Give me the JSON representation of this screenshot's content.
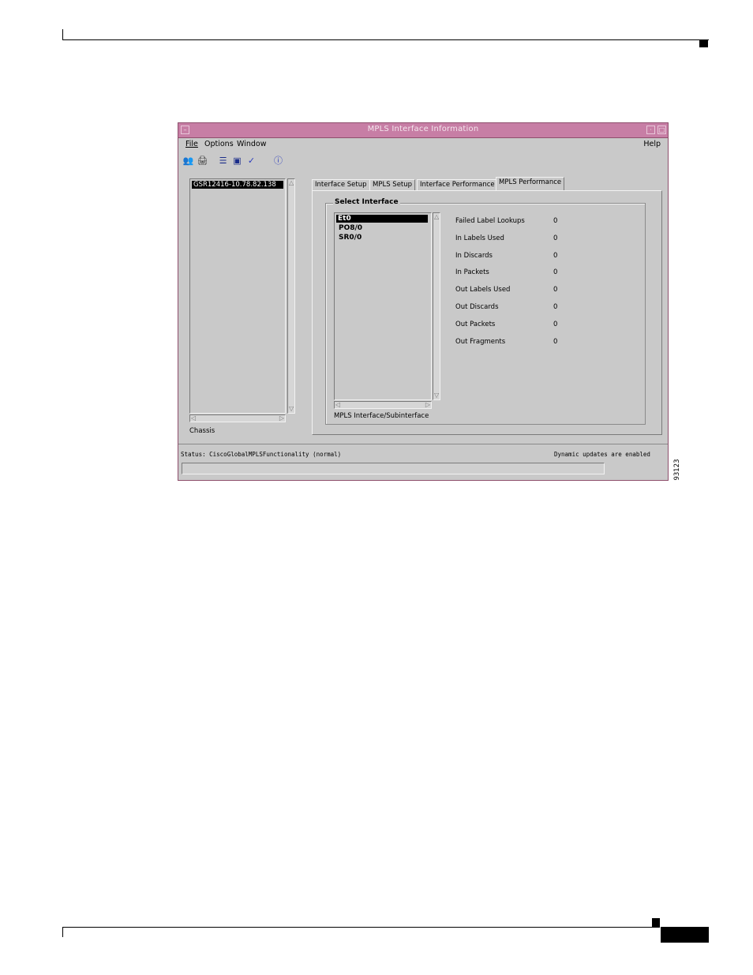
{
  "window": {
    "title": "MPLS Interface Information"
  },
  "menu": {
    "file": "File",
    "options": "Options",
    "window": "Window",
    "help": "Help"
  },
  "toolbar": {
    "icons": [
      "user-icon",
      "print-icon",
      "list-icon",
      "monitor-icon",
      "check-icon",
      "info-icon"
    ]
  },
  "chassis": {
    "selected_item": "GSR12416-10.78.82.138",
    "label": "Chassis"
  },
  "tabs": [
    {
      "label": "Interface Setup",
      "active": false
    },
    {
      "label": "MPLS Setup",
      "active": false
    },
    {
      "label": "Interface Performance",
      "active": false
    },
    {
      "label": "MPLS Performance",
      "active": true
    }
  ],
  "select_interface": {
    "title": "Select Interface",
    "items": [
      "Et0",
      "PO8/0",
      "SR0/0"
    ],
    "selected": "Et0",
    "list_label": "MPLS Interface/Subinterface"
  },
  "stats": [
    {
      "label": "Failed Label Lookups",
      "value": "0"
    },
    {
      "label": "In Labels Used",
      "value": "0"
    },
    {
      "label": "In Discards",
      "value": "0"
    },
    {
      "label": "In Packets",
      "value": "0"
    },
    {
      "label": "Out Labels Used",
      "value": "0"
    },
    {
      "label": "Out Discards",
      "value": "0"
    },
    {
      "label": "Out Packets",
      "value": "0"
    },
    {
      "label": "Out Fragments",
      "value": "0"
    }
  ],
  "status": {
    "text": "Status: CiscoGlobalMPLSFunctionality (normal)",
    "updates": "Dynamic updates are enabled"
  },
  "figure_number": "93123",
  "colors": {
    "titlebar": "#c77ea5",
    "window_bg": "#c9c9c9",
    "selection": "#000000"
  }
}
